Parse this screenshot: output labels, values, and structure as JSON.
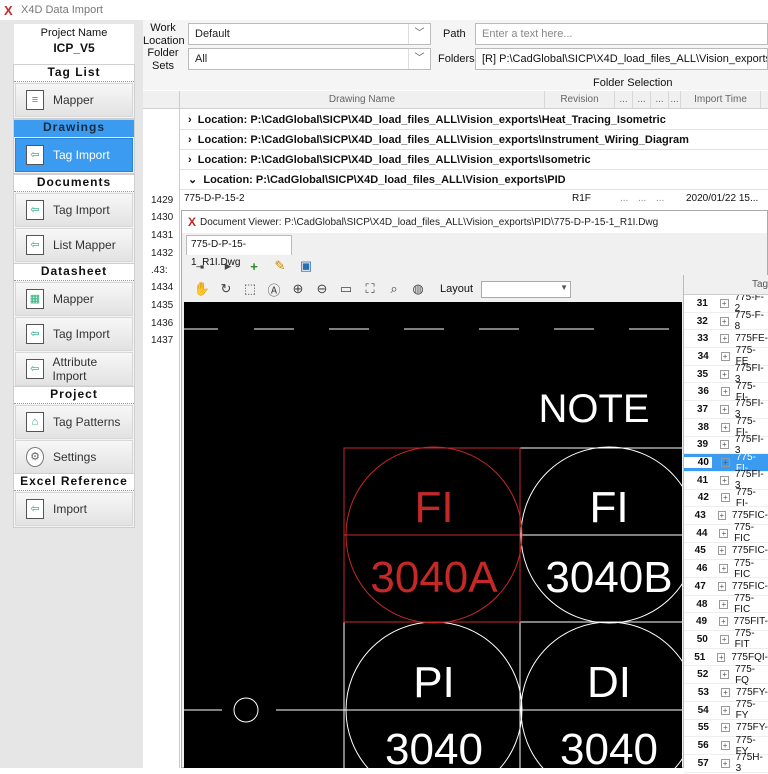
{
  "window": {
    "title": "X4D Data Import"
  },
  "project": {
    "label": "Project Name",
    "value": "ICP_V5"
  },
  "sidebar": {
    "groups": [
      {
        "title": "Tag List",
        "buttons": [
          "Mapper"
        ]
      },
      {
        "title": "Drawings",
        "buttons": [
          "Tag Import"
        ]
      },
      {
        "title": "Documents",
        "buttons": [
          "Tag Import",
          "List Mapper"
        ]
      },
      {
        "title": "Datasheet",
        "buttons": [
          "Mapper",
          "Tag Import",
          "Attribute Import"
        ]
      },
      {
        "title": "Project",
        "buttons": [
          "Tag Patterns",
          "Settings"
        ]
      },
      {
        "title": "Excel Reference",
        "buttons": [
          "Import"
        ]
      }
    ]
  },
  "topbar": {
    "work_location_label": "Work\nLocation",
    "work_location_value": "Default",
    "folder_sets_label": "Folder\nSets",
    "folder_sets_value": "All",
    "path_label": "Path",
    "path_placeholder": "Enter a text here...",
    "folders_label": "Folders",
    "folders_value": "[R] P:\\CadGlobal\\SICP\\X4D_load_files_ALL\\Vision_exports",
    "folder_selection": "Folder Selection"
  },
  "grid": {
    "columns": {
      "drawing_name": "Drawing Name",
      "revision": "Revision",
      "dots": "...",
      "import_time": "Import Time"
    },
    "groups": [
      "Location: P:\\CadGlobal\\SICP\\X4D_load_files_ALL\\Vision_exports\\Heat_Tracing_Isometric",
      "Location: P:\\CadGlobal\\SICP\\X4D_load_files_ALL\\Vision_exports\\Instrument_Wiring_Diagram",
      "Location: P:\\CadGlobal\\SICP\\X4D_load_files_ALL\\Vision_exports\\Isometric",
      "Location: P:\\CadGlobal\\SICP\\X4D_load_files_ALL\\Vision_exports\\PID"
    ],
    "row_numbers": [
      "1429",
      "1430",
      "1431",
      "1432",
      ".43:",
      "1434",
      "1435",
      "1436",
      "1437"
    ],
    "row": {
      "name": "775-D-P-15-2",
      "revision": "R1F",
      "time": "2020/01/22 15..."
    }
  },
  "viewer": {
    "title": "Document Viewer: P:\\CadGlobal\\SICP\\X4D_load_files_ALL\\Vision_exports\\PID\\775-D-P-15-1_R1I.Dwg",
    "tab": "775-D-P-15-1_R1I.Dwg",
    "layout_label": "Layout",
    "drawing": {
      "note": "NOTE",
      "bubbles": [
        {
          "top": "FI",
          "bottom": "3040A",
          "highlight": true
        },
        {
          "top": "FI",
          "bottom": "3040B",
          "highlight": false
        },
        {
          "top": "PI",
          "bottom": "3040",
          "highlight": false
        },
        {
          "top": "DI",
          "bottom": "3040",
          "highlight": false
        }
      ]
    },
    "tag_header": "Tag",
    "tags": [
      {
        "n": "31",
        "t": "775-F-2"
      },
      {
        "n": "32",
        "t": "775-F-8"
      },
      {
        "n": "33",
        "t": "775FE-"
      },
      {
        "n": "34",
        "t": "775-FE"
      },
      {
        "n": "35",
        "t": "775FI-3"
      },
      {
        "n": "36",
        "t": "775-FI-"
      },
      {
        "n": "37",
        "t": "775FI-3"
      },
      {
        "n": "38",
        "t": "775-FI-"
      },
      {
        "n": "39",
        "t": "775FI-3"
      },
      {
        "n": "40",
        "t": "775-FI-",
        "sel": true
      },
      {
        "n": "41",
        "t": "775FI-3"
      },
      {
        "n": "42",
        "t": "775-FI-"
      },
      {
        "n": "43",
        "t": "775FIC-"
      },
      {
        "n": "44",
        "t": "775-FIC"
      },
      {
        "n": "45",
        "t": "775FIC-"
      },
      {
        "n": "46",
        "t": "775-FIC"
      },
      {
        "n": "47",
        "t": "775FIC-"
      },
      {
        "n": "48",
        "t": "775-FIC"
      },
      {
        "n": "49",
        "t": "775FIT-"
      },
      {
        "n": "50",
        "t": "775-FIT"
      },
      {
        "n": "51",
        "t": "775FQI-"
      },
      {
        "n": "52",
        "t": "775-FQ"
      },
      {
        "n": "53",
        "t": "775FY-"
      },
      {
        "n": "54",
        "t": "775-FY"
      },
      {
        "n": "55",
        "t": "775FY-"
      },
      {
        "n": "56",
        "t": "775-FY"
      },
      {
        "n": "57",
        "t": "775H-3"
      }
    ]
  },
  "colors": {
    "accent": "#3a9bf0",
    "highlight": "#c62828"
  }
}
